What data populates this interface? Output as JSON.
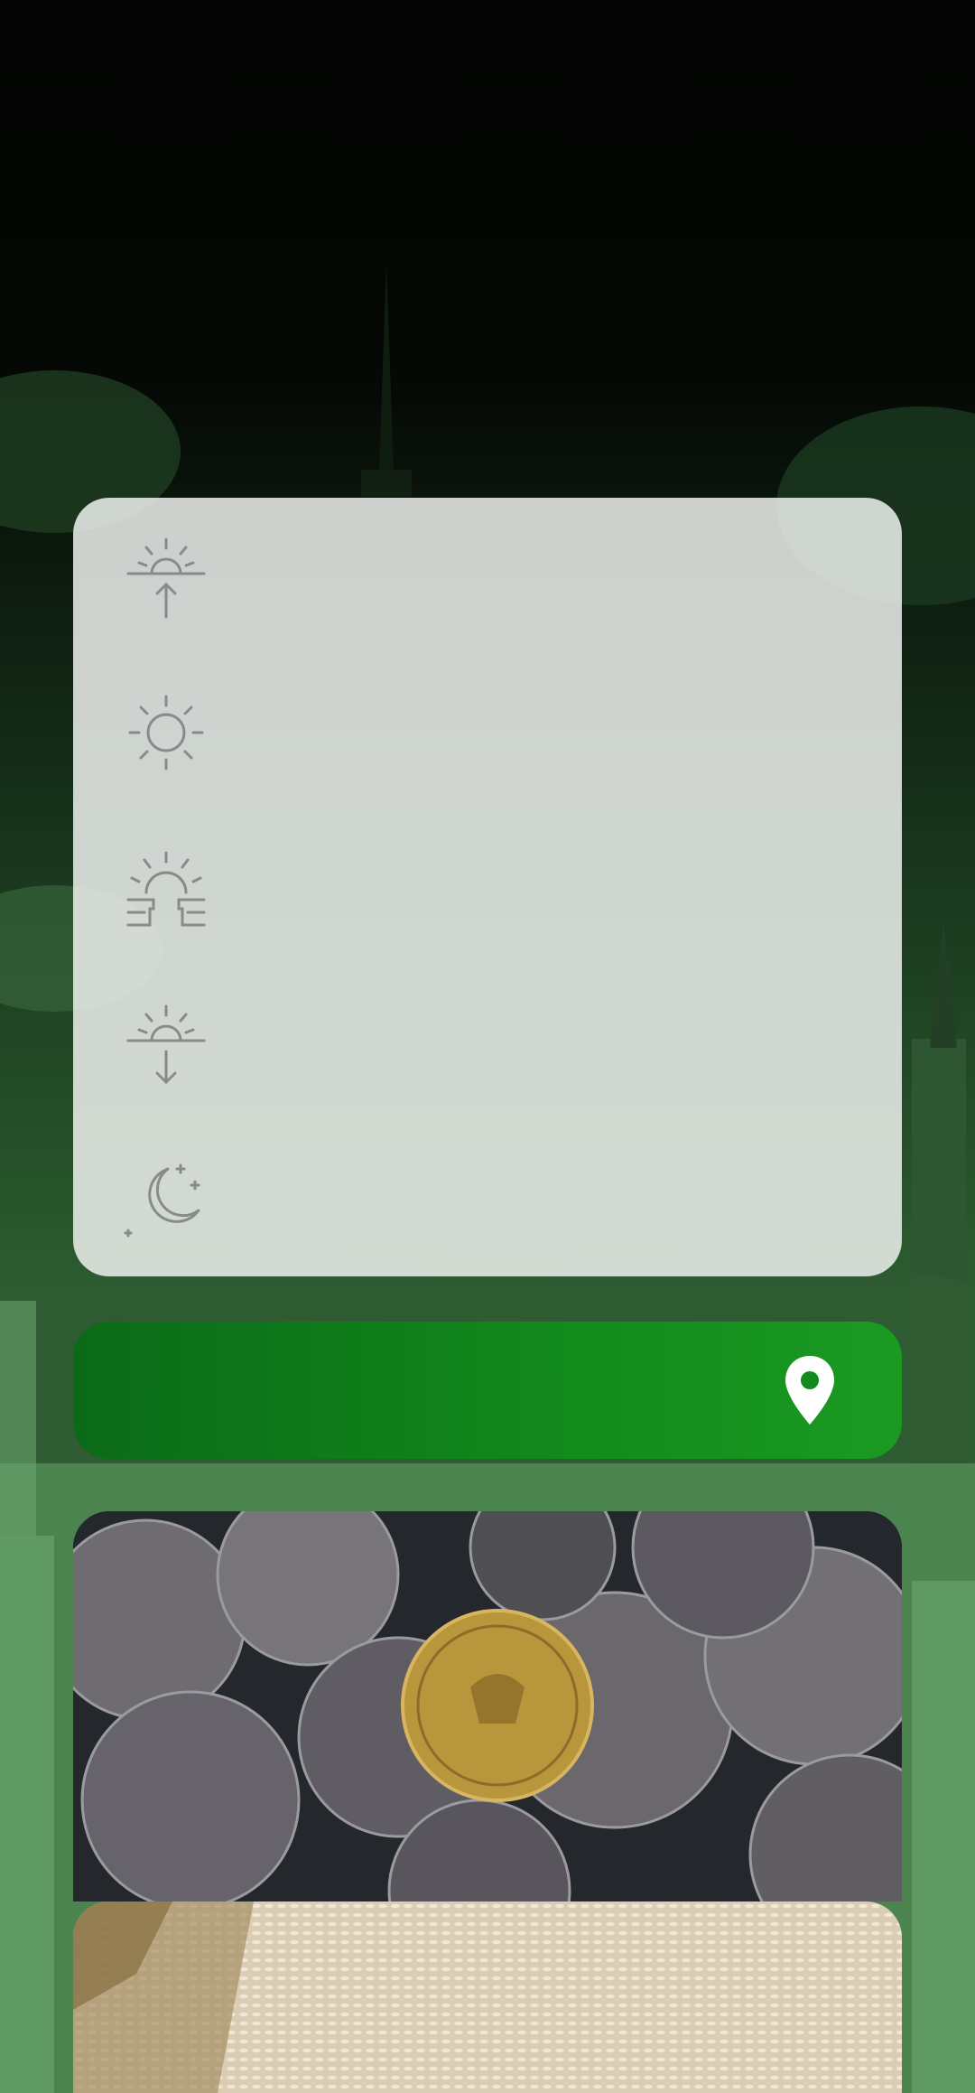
{
  "colors": {
    "background": "#060806",
    "card": "#eef0ee",
    "location_bar": "#128a1c",
    "icon_stroke": "#8a8a8a"
  },
  "prayer_list": {
    "items": [
      {
        "icon": "sunrise-up-icon"
      },
      {
        "icon": "sun-icon"
      },
      {
        "icon": "sun-over-dome-icon"
      },
      {
        "icon": "sunset-down-icon"
      },
      {
        "icon": "moon-stars-icon"
      }
    ]
  },
  "location": {
    "icon": "map-pin-icon"
  },
  "cards": [
    {
      "name": "coins-card",
      "image": "coins-photo"
    },
    {
      "name": "rice-card",
      "image": "rice-photo"
    }
  ]
}
